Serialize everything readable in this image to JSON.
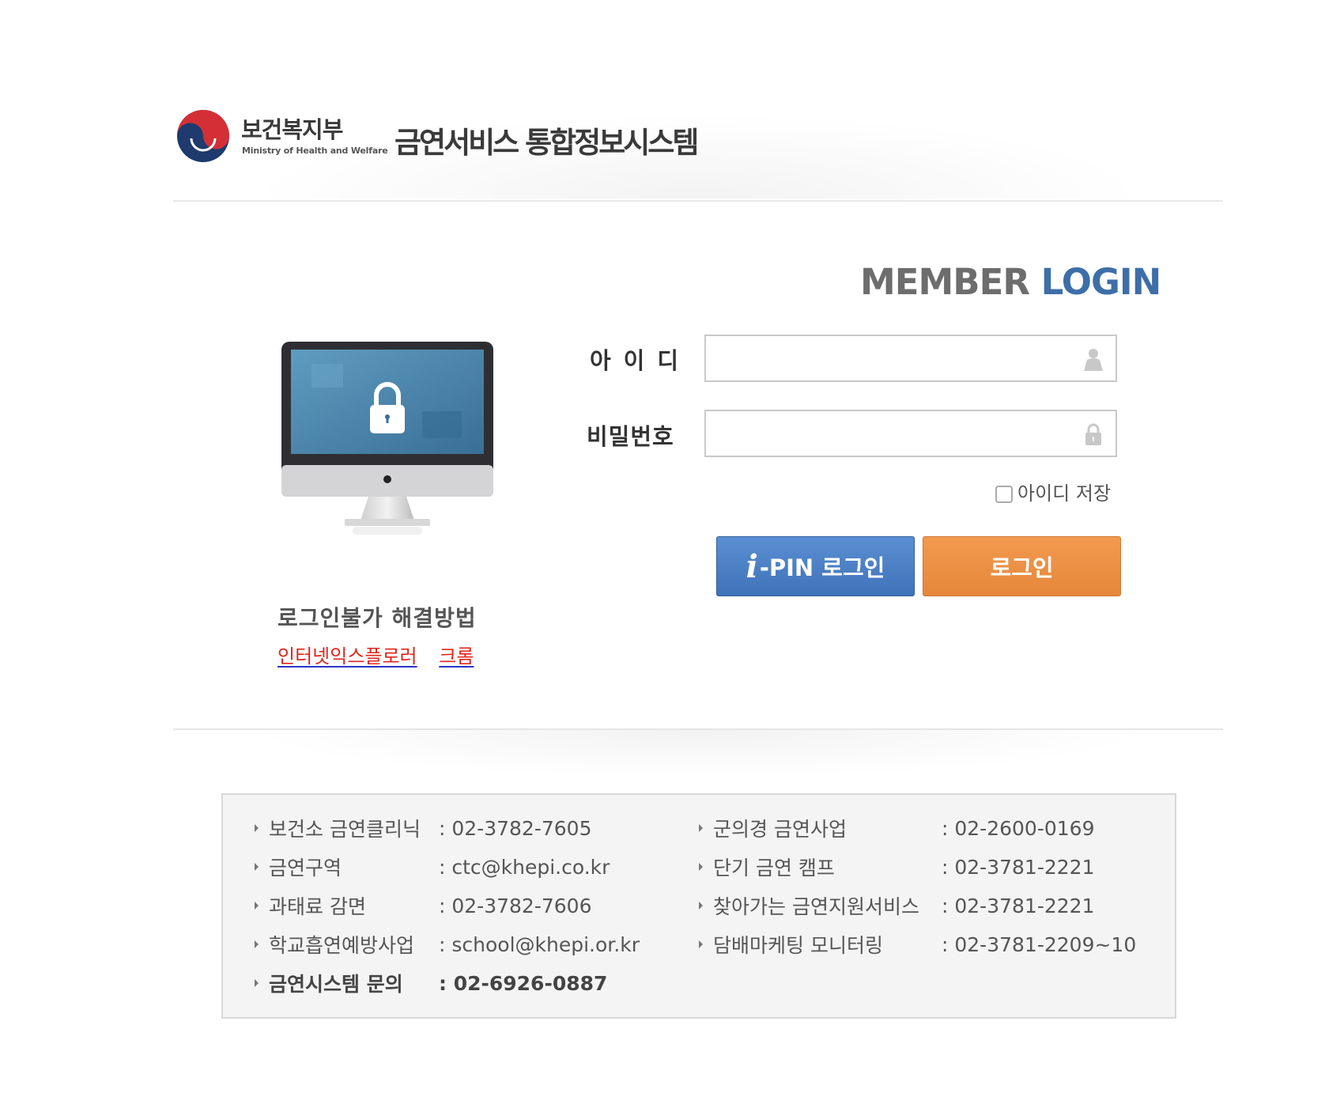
{
  "header": {
    "ministry_ko": "보건복지부",
    "ministry_en": "Ministry of Health and Welfare",
    "system_title": "금연서비스 통합정보시스템"
  },
  "login": {
    "heading_part1": "MEMBER",
    "heading_part2": "LOGIN",
    "id_label": "아이디",
    "password_label": "비밀번호",
    "id_value": "",
    "password_value": "",
    "save_id_label": "아이디 저장",
    "save_id_checked": false,
    "ipin_button_i": "i",
    "ipin_button_label": "-PIN 로그인",
    "login_button_label": "로그인"
  },
  "help": {
    "title": "로그인불가 해결방법",
    "links": [
      "인터넷익스플로러",
      "크롬"
    ]
  },
  "contacts": {
    "left": [
      {
        "label": "보건소 금연클리닉",
        "value": ": 02-3782-7605"
      },
      {
        "label": "금연구역",
        "value": ": ctc@khepi.co.kr"
      },
      {
        "label": "과태료 감면",
        "value": ": 02-3782-7606"
      },
      {
        "label": "학교흡연예방사업",
        "value": ": school@khepi.or.kr"
      },
      {
        "label": "금연시스템 문의",
        "value": ": 02-6926-0887"
      }
    ],
    "right": [
      {
        "label": "군의경 금연사업",
        "value": ": 02-2600-0169"
      },
      {
        "label": "단기 금연 캠프",
        "value": ": 02-3781-2221"
      },
      {
        "label": "찾아가는 금연지원서비스",
        "value": ": 02-3781-2221"
      },
      {
        "label": "담배마케팅 모니터링",
        "value": ": 02-3781-2209~10"
      }
    ]
  },
  "colors": {
    "accent_blue": "#3e6ea8",
    "ipin_button": "#4a7fc4",
    "login_button": "#e98e40",
    "help_link": "#e0261d"
  }
}
